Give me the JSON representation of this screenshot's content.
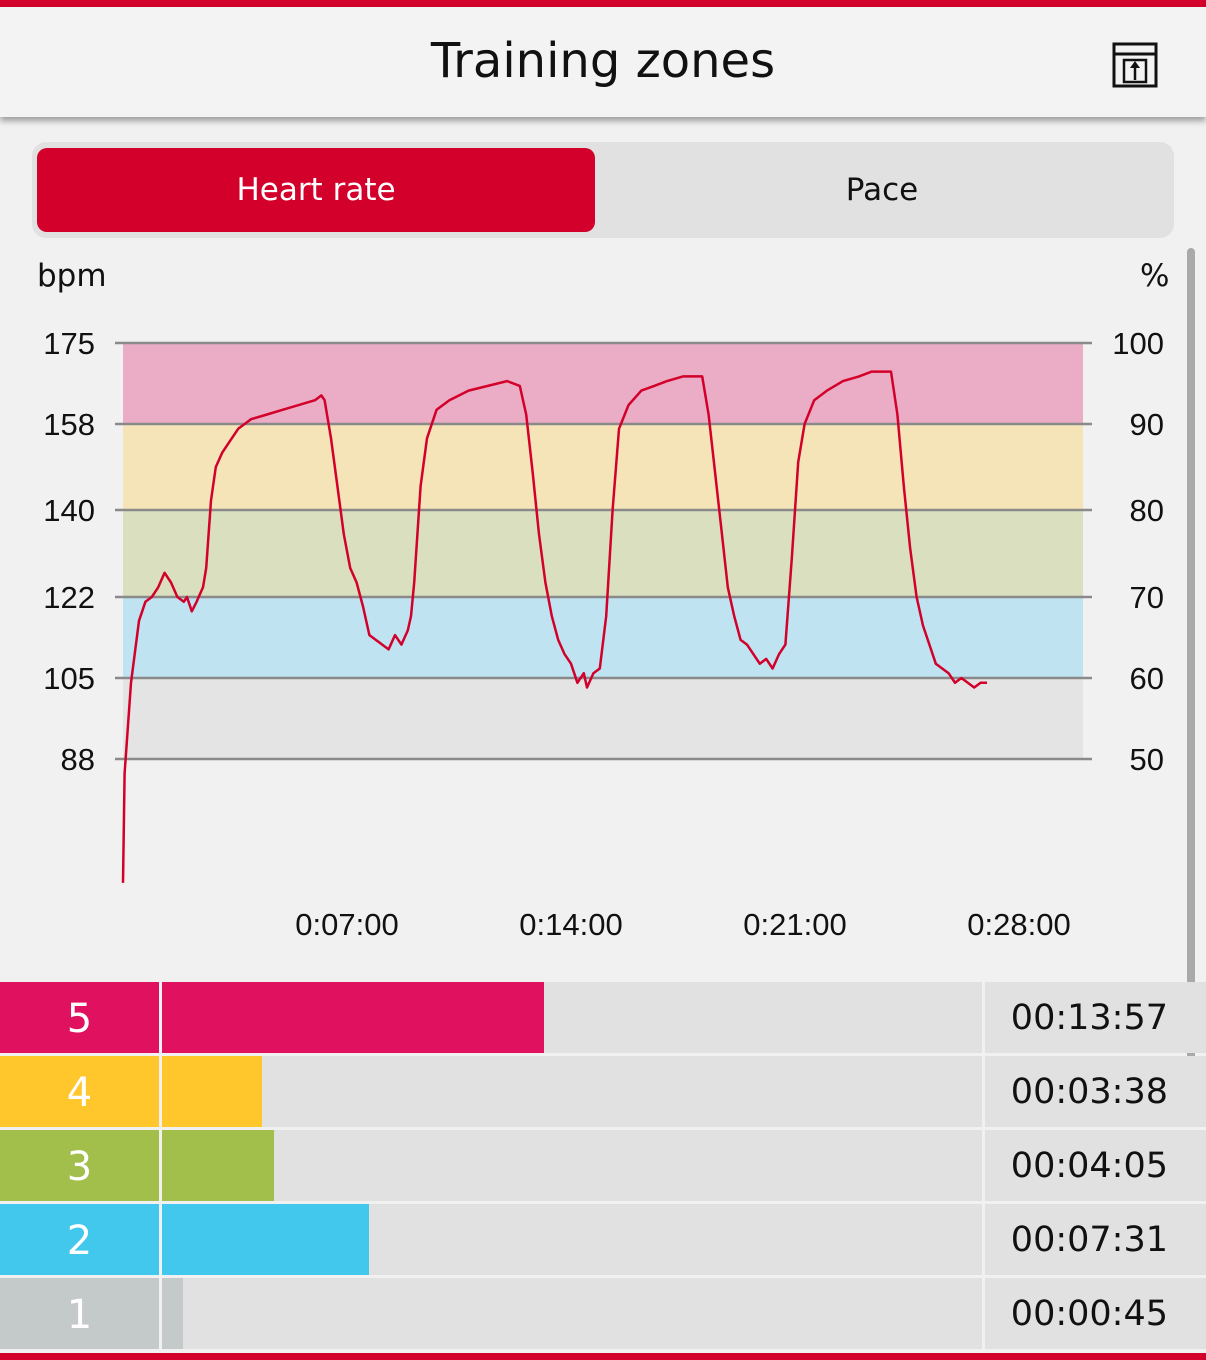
{
  "header": {
    "title": "Training zones",
    "export_icon": "export-icon"
  },
  "tabs": [
    {
      "label": "Heart rate",
      "active": true
    },
    {
      "label": "Pace",
      "active": false
    }
  ],
  "colors": {
    "accent": "#d2002a",
    "zone5": "#e0115f",
    "zone4": "#ffc72c",
    "zone3": "#a1bf4a",
    "zone2": "#42c8ec",
    "zone1": "#c4cac9",
    "band5": "#ebadc5",
    "band4": "#f5e4b8",
    "band3": "#dae0bf",
    "band2": "#bfe3f0",
    "band1": "#e4e4e4",
    "line": "#d2002a"
  },
  "chart_data": {
    "type": "line",
    "y_left_label": "bpm",
    "y_right_label": "%",
    "y_left_ticks": [
      "175",
      "158",
      "140",
      "122",
      "105",
      "88"
    ],
    "y_right_ticks": [
      "100",
      "90",
      "80",
      "70",
      "60",
      "50"
    ],
    "x_ticks": [
      "0:07:00",
      "0:14:00",
      "0:21:00",
      "0:28:00"
    ],
    "x_tick_minutes": [
      7,
      14,
      21,
      28
    ],
    "x_range_minutes": [
      0,
      30
    ],
    "ylim_bpm": [
      88,
      175
    ],
    "zone_bounds_bpm": [
      88,
      105,
      122,
      140,
      158,
      175
    ],
    "series": [
      {
        "points": [
          [
            0.0,
            62
          ],
          [
            0.05,
            85
          ],
          [
            0.25,
            104
          ],
          [
            0.5,
            117
          ],
          [
            0.7,
            121
          ],
          [
            0.9,
            122
          ],
          [
            1.1,
            124
          ],
          [
            1.3,
            127
          ],
          [
            1.5,
            125
          ],
          [
            1.7,
            122
          ],
          [
            1.9,
            121
          ],
          [
            2.0,
            122
          ],
          [
            2.15,
            119
          ],
          [
            2.3,
            121
          ],
          [
            2.5,
            124
          ],
          [
            2.6,
            128
          ],
          [
            2.75,
            142
          ],
          [
            2.9,
            149
          ],
          [
            3.1,
            152
          ],
          [
            3.3,
            154
          ],
          [
            3.6,
            157
          ],
          [
            4.0,
            159
          ],
          [
            4.5,
            160
          ],
          [
            5.0,
            161
          ],
          [
            5.5,
            162
          ],
          [
            6.0,
            163
          ],
          [
            6.2,
            164
          ],
          [
            6.3,
            163
          ],
          [
            6.5,
            155
          ],
          [
            6.7,
            145
          ],
          [
            6.9,
            135
          ],
          [
            7.1,
            128
          ],
          [
            7.3,
            125
          ],
          [
            7.5,
            120
          ],
          [
            7.7,
            114
          ],
          [
            7.9,
            113
          ],
          [
            8.1,
            112
          ],
          [
            8.3,
            111
          ],
          [
            8.5,
            114
          ],
          [
            8.7,
            112
          ],
          [
            8.9,
            115
          ],
          [
            9.0,
            118
          ],
          [
            9.1,
            125
          ],
          [
            9.3,
            145
          ],
          [
            9.5,
            155
          ],
          [
            9.8,
            161
          ],
          [
            10.2,
            163
          ],
          [
            10.8,
            165
          ],
          [
            11.4,
            166
          ],
          [
            12.0,
            167
          ],
          [
            12.4,
            166
          ],
          [
            12.6,
            160
          ],
          [
            12.8,
            148
          ],
          [
            13.0,
            135
          ],
          [
            13.2,
            125
          ],
          [
            13.4,
            118
          ],
          [
            13.6,
            113
          ],
          [
            13.8,
            110
          ],
          [
            14.0,
            108
          ],
          [
            14.2,
            104
          ],
          [
            14.4,
            106
          ],
          [
            14.5,
            103
          ],
          [
            14.7,
            106
          ],
          [
            14.9,
            107
          ],
          [
            15.1,
            118
          ],
          [
            15.3,
            140
          ],
          [
            15.5,
            157
          ],
          [
            15.8,
            162
          ],
          [
            16.2,
            165
          ],
          [
            16.6,
            166
          ],
          [
            17.0,
            167
          ],
          [
            17.5,
            168
          ],
          [
            18.1,
            168
          ],
          [
            18.3,
            160
          ],
          [
            18.5,
            148
          ],
          [
            18.7,
            136
          ],
          [
            18.9,
            124
          ],
          [
            19.1,
            118
          ],
          [
            19.3,
            113
          ],
          [
            19.5,
            112
          ],
          [
            19.7,
            110
          ],
          [
            19.9,
            108
          ],
          [
            20.1,
            109
          ],
          [
            20.3,
            107
          ],
          [
            20.5,
            110
          ],
          [
            20.7,
            112
          ],
          [
            20.9,
            130
          ],
          [
            21.1,
            150
          ],
          [
            21.3,
            158
          ],
          [
            21.6,
            163
          ],
          [
            22.0,
            165
          ],
          [
            22.5,
            167
          ],
          [
            23.0,
            168
          ],
          [
            23.4,
            169
          ],
          [
            24.0,
            169
          ],
          [
            24.2,
            160
          ],
          [
            24.4,
            145
          ],
          [
            24.6,
            132
          ],
          [
            24.8,
            122
          ],
          [
            25.0,
            116
          ],
          [
            25.2,
            112
          ],
          [
            25.4,
            108
          ],
          [
            25.6,
            107
          ],
          [
            25.8,
            106
          ],
          [
            26.0,
            104
          ],
          [
            26.2,
            105
          ],
          [
            26.4,
            104
          ],
          [
            26.6,
            103
          ],
          [
            26.8,
            104
          ],
          [
            27.0,
            104
          ]
        ]
      }
    ]
  },
  "zones": [
    {
      "label": "5",
      "time": "00:13:57",
      "fraction": 0.466
    },
    {
      "label": "4",
      "time": "00:03:38",
      "fraction": 0.122
    },
    {
      "label": "3",
      "time": "00:04:05",
      "fraction": 0.137
    },
    {
      "label": "2",
      "time": "00:07:31",
      "fraction": 0.252
    },
    {
      "label": "1",
      "time": "00:00:45",
      "fraction": 0.025
    }
  ]
}
